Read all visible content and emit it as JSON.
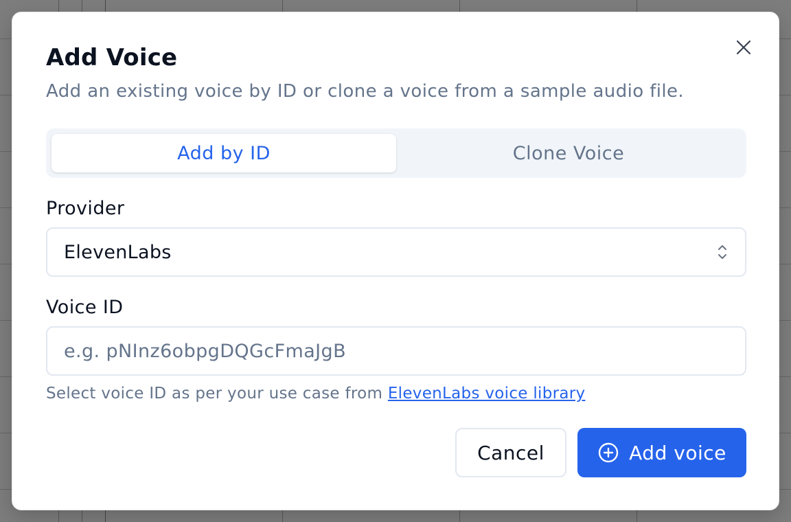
{
  "dialog": {
    "title": "Add Voice",
    "subtitle": "Add an existing voice by ID or clone a voice from a sample audio file.",
    "close_icon": "close-icon"
  },
  "tabs": [
    {
      "label": "Add by ID",
      "active": true
    },
    {
      "label": "Clone Voice",
      "active": false
    }
  ],
  "provider": {
    "label": "Provider",
    "value": "ElevenLabs",
    "icon": "chevron-up-down-icon"
  },
  "voice_id": {
    "label": "Voice ID",
    "value": "",
    "placeholder": "e.g. pNInz6obpgDQGcFmaJgB"
  },
  "helper": {
    "text": "Select voice ID as per your use case from ",
    "link_text": "ElevenLabs voice library"
  },
  "buttons": {
    "cancel_label": "Cancel",
    "add_label": "Add voice",
    "add_icon": "plus-circle-icon"
  },
  "colors": {
    "primary": "#2563eb",
    "text": "#0b1220",
    "muted": "#64748b",
    "border": "#e2e8f0",
    "tab_bg": "#f1f5f9"
  }
}
